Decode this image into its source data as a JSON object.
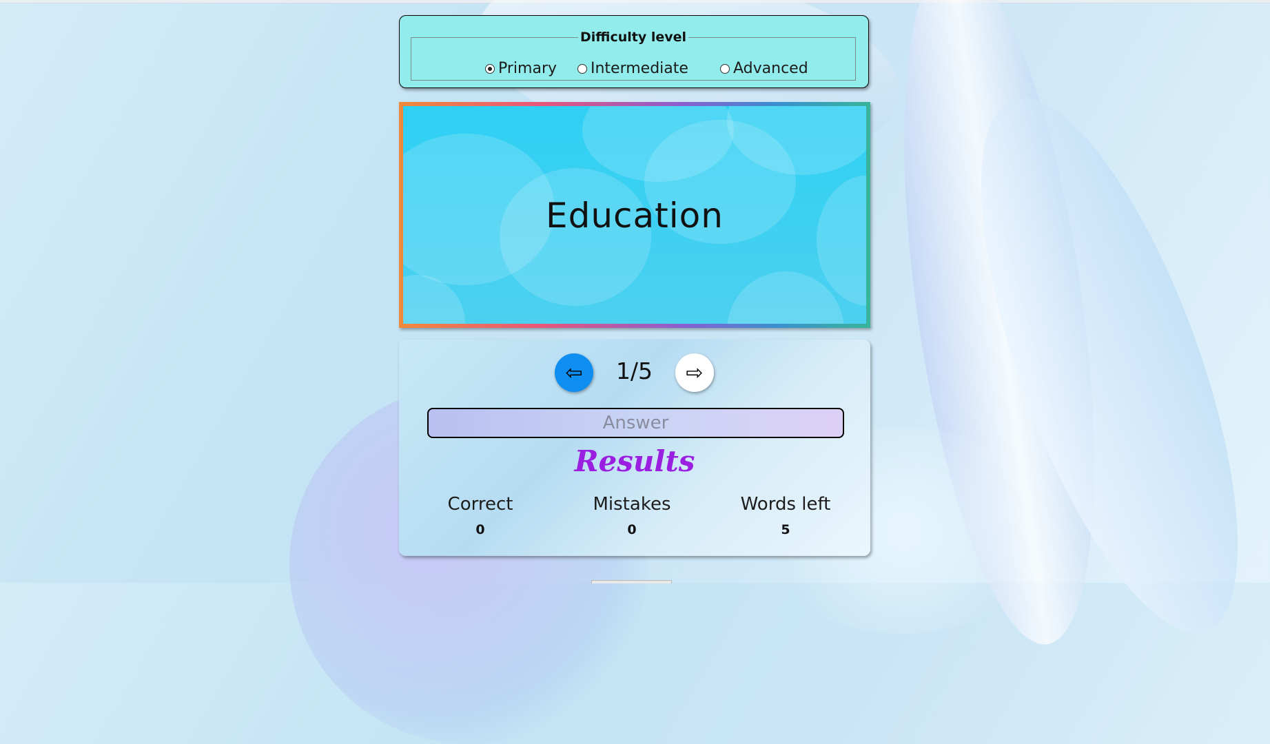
{
  "difficulty": {
    "legend": "Difficulty level",
    "options": [
      {
        "label": "Primary",
        "selected": true
      },
      {
        "label": "Intermediate",
        "selected": false
      },
      {
        "label": "Advanced",
        "selected": false
      }
    ]
  },
  "card": {
    "word": "Education"
  },
  "navigation": {
    "prev_icon": "⇦",
    "next_icon": "⇨",
    "counter": "1/5"
  },
  "answer": {
    "placeholder": "Answer",
    "value": ""
  },
  "results": {
    "title": "Results",
    "stats": [
      {
        "label": "Correct",
        "value": "0"
      },
      {
        "label": "Mistakes",
        "value": "0"
      },
      {
        "label": "Words left",
        "value": "5"
      }
    ]
  },
  "colors": {
    "difficulty_bg": "#92eceb",
    "card_bg": "#2ed0f4",
    "prev_button": "#0f8ef2",
    "next_button": "#ffffff",
    "results_title": "#9b1fe0"
  }
}
